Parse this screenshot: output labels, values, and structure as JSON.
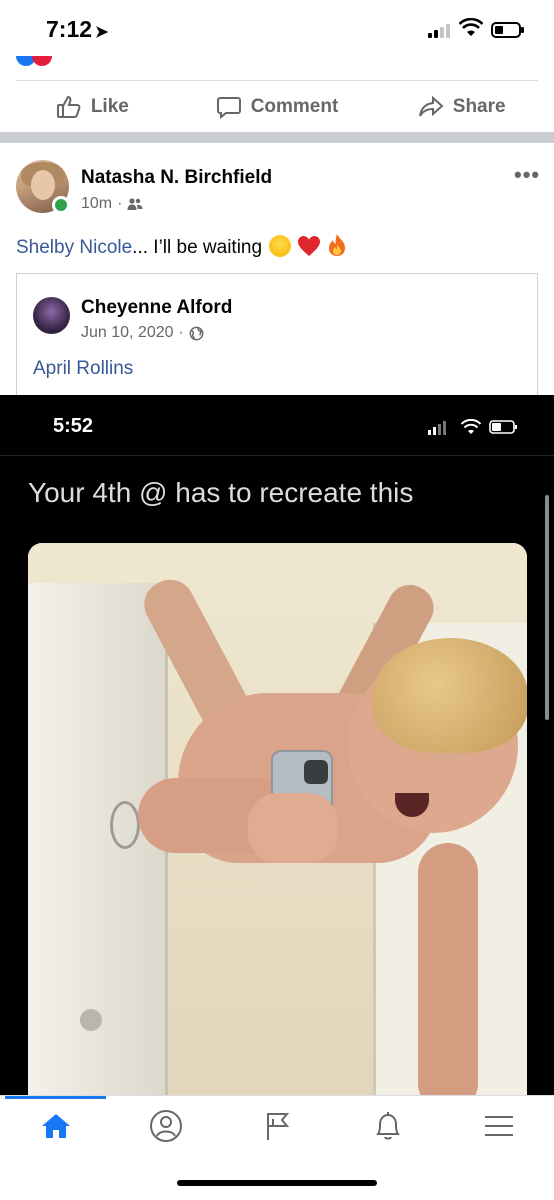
{
  "status_bar": {
    "time": "7:12",
    "location_arrow": "location-arrow-icon",
    "battery_percent": 25
  },
  "actions": {
    "like_label": "Like",
    "comment_label": "Comment",
    "share_label": "Share"
  },
  "post": {
    "author": "Natasha N. Birchfield",
    "timestamp": "10m",
    "separator": "·",
    "audience_icon": "friends-icon",
    "more_label": "•••",
    "text": {
      "mention": "Shelby Nicole",
      "body": "... I’ll be waiting"
    },
    "emojis": [
      "laughing-emoji",
      "red-heart-emoji",
      "fire-emoji"
    ]
  },
  "shared_post": {
    "author": "Cheyenne Alford",
    "date": "Jun 10, 2020",
    "separator": "·",
    "audience_icon": "globe-icon",
    "mention": "April Rollins",
    "embedded_screenshot": {
      "time": "5:52",
      "caption": "Your 4th @ has to recreate this"
    }
  },
  "tab_bar": {
    "tabs": [
      "home-icon",
      "profile-icon",
      "pages-flag-icon",
      "notifications-bell-icon",
      "menu-icon"
    ],
    "active": "home-icon"
  },
  "colors": {
    "accent": "#1877f2",
    "link": "#385898",
    "secondary_text": "#65676b",
    "online": "#31a24c"
  }
}
